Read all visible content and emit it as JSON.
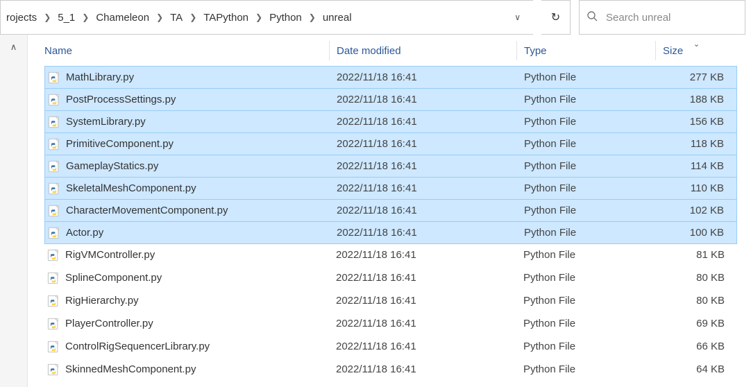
{
  "breadcrumbs": [
    "rojects",
    "5_1",
    "Chameleon",
    "TA",
    "TAPython",
    "Python",
    "unreal"
  ],
  "search": {
    "placeholder": "Search unreal"
  },
  "columns": {
    "name": "Name",
    "date": "Date modified",
    "type": "Type",
    "size": "Size"
  },
  "files": [
    {
      "name": "MathLibrary.py",
      "date": "2022/11/18 16:41",
      "type": "Python File",
      "size": "277 KB",
      "selected": true
    },
    {
      "name": "PostProcessSettings.py",
      "date": "2022/11/18 16:41",
      "type": "Python File",
      "size": "188 KB",
      "selected": true
    },
    {
      "name": "SystemLibrary.py",
      "date": "2022/11/18 16:41",
      "type": "Python File",
      "size": "156 KB",
      "selected": true
    },
    {
      "name": "PrimitiveComponent.py",
      "date": "2022/11/18 16:41",
      "type": "Python File",
      "size": "118 KB",
      "selected": true
    },
    {
      "name": "GameplayStatics.py",
      "date": "2022/11/18 16:41",
      "type": "Python File",
      "size": "114 KB",
      "selected": true
    },
    {
      "name": "SkeletalMeshComponent.py",
      "date": "2022/11/18 16:41",
      "type": "Python File",
      "size": "110 KB",
      "selected": true
    },
    {
      "name": "CharacterMovementComponent.py",
      "date": "2022/11/18 16:41",
      "type": "Python File",
      "size": "102 KB",
      "selected": true
    },
    {
      "name": "Actor.py",
      "date": "2022/11/18 16:41",
      "type": "Python File",
      "size": "100 KB",
      "selected": true
    },
    {
      "name": "RigVMController.py",
      "date": "2022/11/18 16:41",
      "type": "Python File",
      "size": "81 KB",
      "selected": false
    },
    {
      "name": "SplineComponent.py",
      "date": "2022/11/18 16:41",
      "type": "Python File",
      "size": "80 KB",
      "selected": false
    },
    {
      "name": "RigHierarchy.py",
      "date": "2022/11/18 16:41",
      "type": "Python File",
      "size": "80 KB",
      "selected": false
    },
    {
      "name": "PlayerController.py",
      "date": "2022/11/18 16:41",
      "type": "Python File",
      "size": "69 KB",
      "selected": false
    },
    {
      "name": "ControlRigSequencerLibrary.py",
      "date": "2022/11/18 16:41",
      "type": "Python File",
      "size": "66 KB",
      "selected": false
    },
    {
      "name": "SkinnedMeshComponent.py",
      "date": "2022/11/18 16:41",
      "type": "Python File",
      "size": "64 KB",
      "selected": false
    }
  ]
}
